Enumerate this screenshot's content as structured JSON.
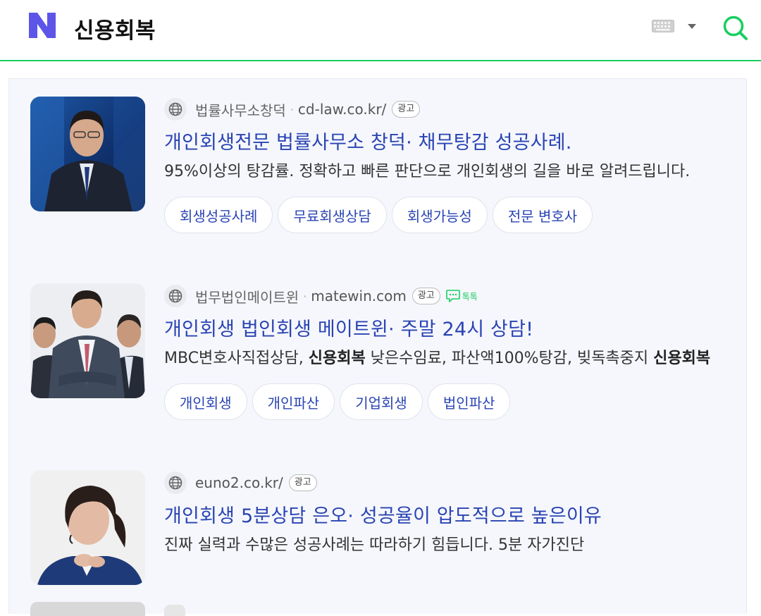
{
  "header": {
    "query": "신용회복",
    "brand_color": "#19ce60",
    "logo_color": "#5c55e8",
    "icons": [
      "naver-logo-icon",
      "keyboard-icon",
      "caret-down-icon",
      "search-icon"
    ]
  },
  "ads": [
    {
      "source_name": "법률사무소창덕",
      "url": "cd-law.co.kr/",
      "badge": "광고",
      "title": "개인회생전문 법률사무소 창덕· 채무탕감 성공사례.",
      "desc": "95%이상의 탕감률. 정확하고 빠른 판단으로 개인회생의 길을 바로 알려드립니다.",
      "chips": [
        "회생성공사례",
        "무료회생상담",
        "회생가능성",
        "전문 변호사"
      ]
    },
    {
      "source_name": "법무법인메이트윈",
      "url": "matewin.com",
      "badge": "광고",
      "talk_label": "톡톡",
      "title": "개인회생 법인회생 메이트윈· 주말 24시 상담!",
      "desc_parts": [
        "MBC변호사직접상담, ",
        "신용회복",
        " 낮은수임료, 파산액100%탕감, 빚독촉중지 ",
        "신용회복"
      ],
      "chips": [
        "개인회생",
        "개인파산",
        "기업회생",
        "법인파산"
      ]
    },
    {
      "url": "euno2.co.kr/",
      "badge": "광고",
      "title": "개인회생 5분상담 은오· 성공율이 압도적으로 높은이유",
      "desc": "진짜 실력과 수많은 성공사례는 따라하기 힘듭니다. 5분 자가진단"
    }
  ]
}
